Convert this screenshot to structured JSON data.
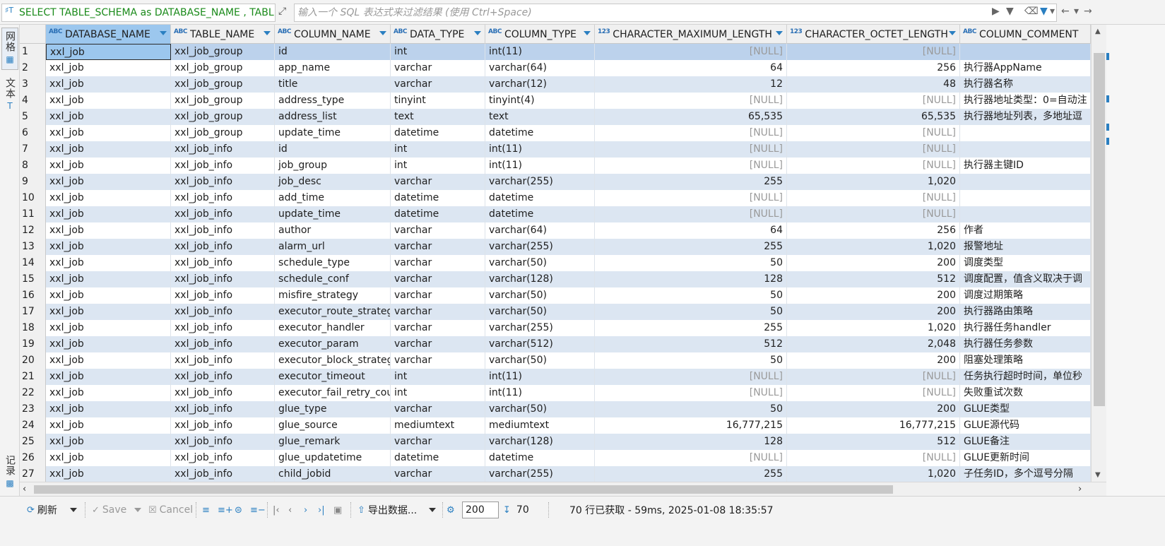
{
  "filter_bar": {
    "query_text": "SELECT TABLE_SCHEMA as DATABASE_NAME , TABLE_NAME",
    "filter_placeholder": "输入一个 SQL 表达式来过滤结果 (使用 Ctrl+Space)"
  },
  "left_tabs": [
    {
      "label": "网格",
      "icon": "grid-icon"
    },
    {
      "label": "文本",
      "icon": "text-icon"
    },
    {
      "label": "记录",
      "icon": "record-icon"
    }
  ],
  "columns": [
    {
      "name": "DATABASE_NAME",
      "type": "ABC"
    },
    {
      "name": "TABLE_NAME",
      "type": "ABC"
    },
    {
      "name": "COLUMN_NAME",
      "type": "ABC"
    },
    {
      "name": "DATA_TYPE",
      "type": "ABC"
    },
    {
      "name": "COLUMN_TYPE",
      "type": "ABC"
    },
    {
      "name": "CHARACTER_MAXIMUM_LENGTH",
      "type": "123"
    },
    {
      "name": "CHARACTER_OCTET_LENGTH",
      "type": "123"
    },
    {
      "name": "COLUMN_COMMENT",
      "type": "ABC"
    }
  ],
  "rows": [
    [
      "1",
      "xxl_job",
      "xxl_job_group",
      "id",
      "int",
      "int(11)",
      "[NULL]",
      "[NULL]",
      ""
    ],
    [
      "2",
      "xxl_job",
      "xxl_job_group",
      "app_name",
      "varchar",
      "varchar(64)",
      "64",
      "256",
      "执行器AppName"
    ],
    [
      "3",
      "xxl_job",
      "xxl_job_group",
      "title",
      "varchar",
      "varchar(12)",
      "12",
      "48",
      "执行器名称"
    ],
    [
      "4",
      "xxl_job",
      "xxl_job_group",
      "address_type",
      "tinyint",
      "tinyint(4)",
      "[NULL]",
      "[NULL]",
      "执行器地址类型：0=自动注"
    ],
    [
      "5",
      "xxl_job",
      "xxl_job_group",
      "address_list",
      "text",
      "text",
      "65,535",
      "65,535",
      "执行器地址列表，多地址逗"
    ],
    [
      "6",
      "xxl_job",
      "xxl_job_group",
      "update_time",
      "datetime",
      "datetime",
      "[NULL]",
      "[NULL]",
      ""
    ],
    [
      "7",
      "xxl_job",
      "xxl_job_info",
      "id",
      "int",
      "int(11)",
      "[NULL]",
      "[NULL]",
      ""
    ],
    [
      "8",
      "xxl_job",
      "xxl_job_info",
      "job_group",
      "int",
      "int(11)",
      "[NULL]",
      "[NULL]",
      "执行器主键ID"
    ],
    [
      "9",
      "xxl_job",
      "xxl_job_info",
      "job_desc",
      "varchar",
      "varchar(255)",
      "255",
      "1,020",
      ""
    ],
    [
      "10",
      "xxl_job",
      "xxl_job_info",
      "add_time",
      "datetime",
      "datetime",
      "[NULL]",
      "[NULL]",
      ""
    ],
    [
      "11",
      "xxl_job",
      "xxl_job_info",
      "update_time",
      "datetime",
      "datetime",
      "[NULL]",
      "[NULL]",
      ""
    ],
    [
      "12",
      "xxl_job",
      "xxl_job_info",
      "author",
      "varchar",
      "varchar(64)",
      "64",
      "256",
      "作者"
    ],
    [
      "13",
      "xxl_job",
      "xxl_job_info",
      "alarm_url",
      "varchar",
      "varchar(255)",
      "255",
      "1,020",
      "报警地址"
    ],
    [
      "14",
      "xxl_job",
      "xxl_job_info",
      "schedule_type",
      "varchar",
      "varchar(50)",
      "50",
      "200",
      "调度类型"
    ],
    [
      "15",
      "xxl_job",
      "xxl_job_info",
      "schedule_conf",
      "varchar",
      "varchar(128)",
      "128",
      "512",
      "调度配置，值含义取决于调"
    ],
    [
      "16",
      "xxl_job",
      "xxl_job_info",
      "misfire_strategy",
      "varchar",
      "varchar(50)",
      "50",
      "200",
      "调度过期策略"
    ],
    [
      "17",
      "xxl_job",
      "xxl_job_info",
      "executor_route_strategy",
      "varchar",
      "varchar(50)",
      "50",
      "200",
      "执行器路由策略"
    ],
    [
      "18",
      "xxl_job",
      "xxl_job_info",
      "executor_handler",
      "varchar",
      "varchar(255)",
      "255",
      "1,020",
      "执行器任务handler"
    ],
    [
      "19",
      "xxl_job",
      "xxl_job_info",
      "executor_param",
      "varchar",
      "varchar(512)",
      "512",
      "2,048",
      "执行器任务参数"
    ],
    [
      "20",
      "xxl_job",
      "xxl_job_info",
      "executor_block_strategy",
      "varchar",
      "varchar(50)",
      "50",
      "200",
      "阻塞处理策略"
    ],
    [
      "21",
      "xxl_job",
      "xxl_job_info",
      "executor_timeout",
      "int",
      "int(11)",
      "[NULL]",
      "[NULL]",
      "任务执行超时时间，单位秒"
    ],
    [
      "22",
      "xxl_job",
      "xxl_job_info",
      "executor_fail_retry_count",
      "int",
      "int(11)",
      "[NULL]",
      "[NULL]",
      "失败重试次数"
    ],
    [
      "23",
      "xxl_job",
      "xxl_job_info",
      "glue_type",
      "varchar",
      "varchar(50)",
      "50",
      "200",
      "GLUE类型"
    ],
    [
      "24",
      "xxl_job",
      "xxl_job_info",
      "glue_source",
      "mediumtext",
      "mediumtext",
      "16,777,215",
      "16,777,215",
      "GLUE源代码"
    ],
    [
      "25",
      "xxl_job",
      "xxl_job_info",
      "glue_remark",
      "varchar",
      "varchar(128)",
      "128",
      "512",
      "GLUE备注"
    ],
    [
      "26",
      "xxl_job",
      "xxl_job_info",
      "glue_updatetime",
      "datetime",
      "datetime",
      "[NULL]",
      "[NULL]",
      "GLUE更新时间"
    ],
    [
      "27",
      "xxl_job",
      "xxl_job_info",
      "child_jobid",
      "varchar",
      "varchar(255)",
      "255",
      "1,020",
      "子任务ID，多个逗号分隔"
    ]
  ],
  "bottom_bar": {
    "refresh_label": "刷新",
    "save_label": "Save",
    "cancel_label": "Cancel",
    "export_label": "导出数据...",
    "fetch_size": "200",
    "row_count": "70",
    "status_text": "70 行已获取 - 59ms, 2025-01-08 18:35:57"
  },
  "colors": {
    "alt_row": "#dce6f2",
    "selected_header": "#9cc7ee",
    "accent": "#2a7fc1",
    "null_text": "#9a9a9a",
    "query_text": "#1a8a1a"
  }
}
